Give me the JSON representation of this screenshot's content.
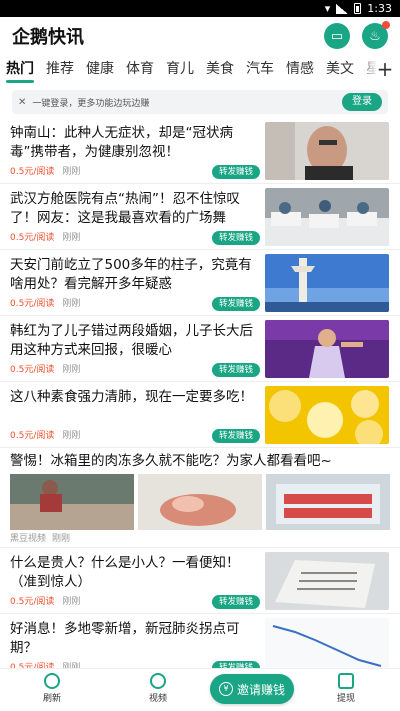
{
  "status_bar": {
    "time": "1:33"
  },
  "header": {
    "title": "企鹅快讯"
  },
  "tabs": [
    "热门",
    "推荐",
    "健康",
    "体育",
    "育儿",
    "美食",
    "汽车",
    "情感",
    "美文",
    "星座"
  ],
  "login_bar": {
    "text": "一键登录，更多功能边玩边赚",
    "button": "登录"
  },
  "articles": [
    {
      "title": "钟南山：此种人无症状，却是“冠状病毒”携带者，为健康别忽视！",
      "price": "0.5元/阅读",
      "time": "刚刚",
      "share": "转发赚钱"
    },
    {
      "title": "武汉方舱医院有点“热闹”！忍不住惊叹了！网友：这是我最喜欢看的广场舞",
      "price": "0.5元/阅读",
      "time": "刚刚",
      "share": "转发赚钱"
    },
    {
      "title": "天安门前屹立了500多年的柱子，究竟有啥用处？看完解开多年疑惑",
      "price": "0.5元/阅读",
      "time": "刚刚",
      "share": "转发赚钱"
    },
    {
      "title": "韩红为了儿子错过两段婚姻，儿子长大后用这种方式来回报，很暖心",
      "price": "0.5元/阅读",
      "time": "刚刚",
      "share": "转发赚钱"
    },
    {
      "title": "这八种素食强力清肺，现在一定要多吃！",
      "price": "0.5元/阅读",
      "time": "刚刚",
      "share": "转发赚钱"
    }
  ],
  "big_article": {
    "title": "警惕！冰箱里的肉冻多久就不能吃？为家人都看看吧~",
    "source": "黑豆视频",
    "time": "刚刚"
  },
  "articles2": [
    {
      "title": "什么是贵人？什么是小人？一看便知！（准到惊人）",
      "price": "0.5元/阅读",
      "time": "刚刚",
      "share": "转发赚钱"
    },
    {
      "title": "好消息！多地零新增，新冠肺炎拐点可期？",
      "price": "0.5元/阅读",
      "time": "刚刚",
      "share": "转发赚钱"
    }
  ],
  "bottom_nav": {
    "refresh": "刷新",
    "video": "视频",
    "invite": "邀请赚钱",
    "withdraw": "提现"
  },
  "colors": {
    "accent": "#1aa584",
    "price": "#f0502c"
  }
}
